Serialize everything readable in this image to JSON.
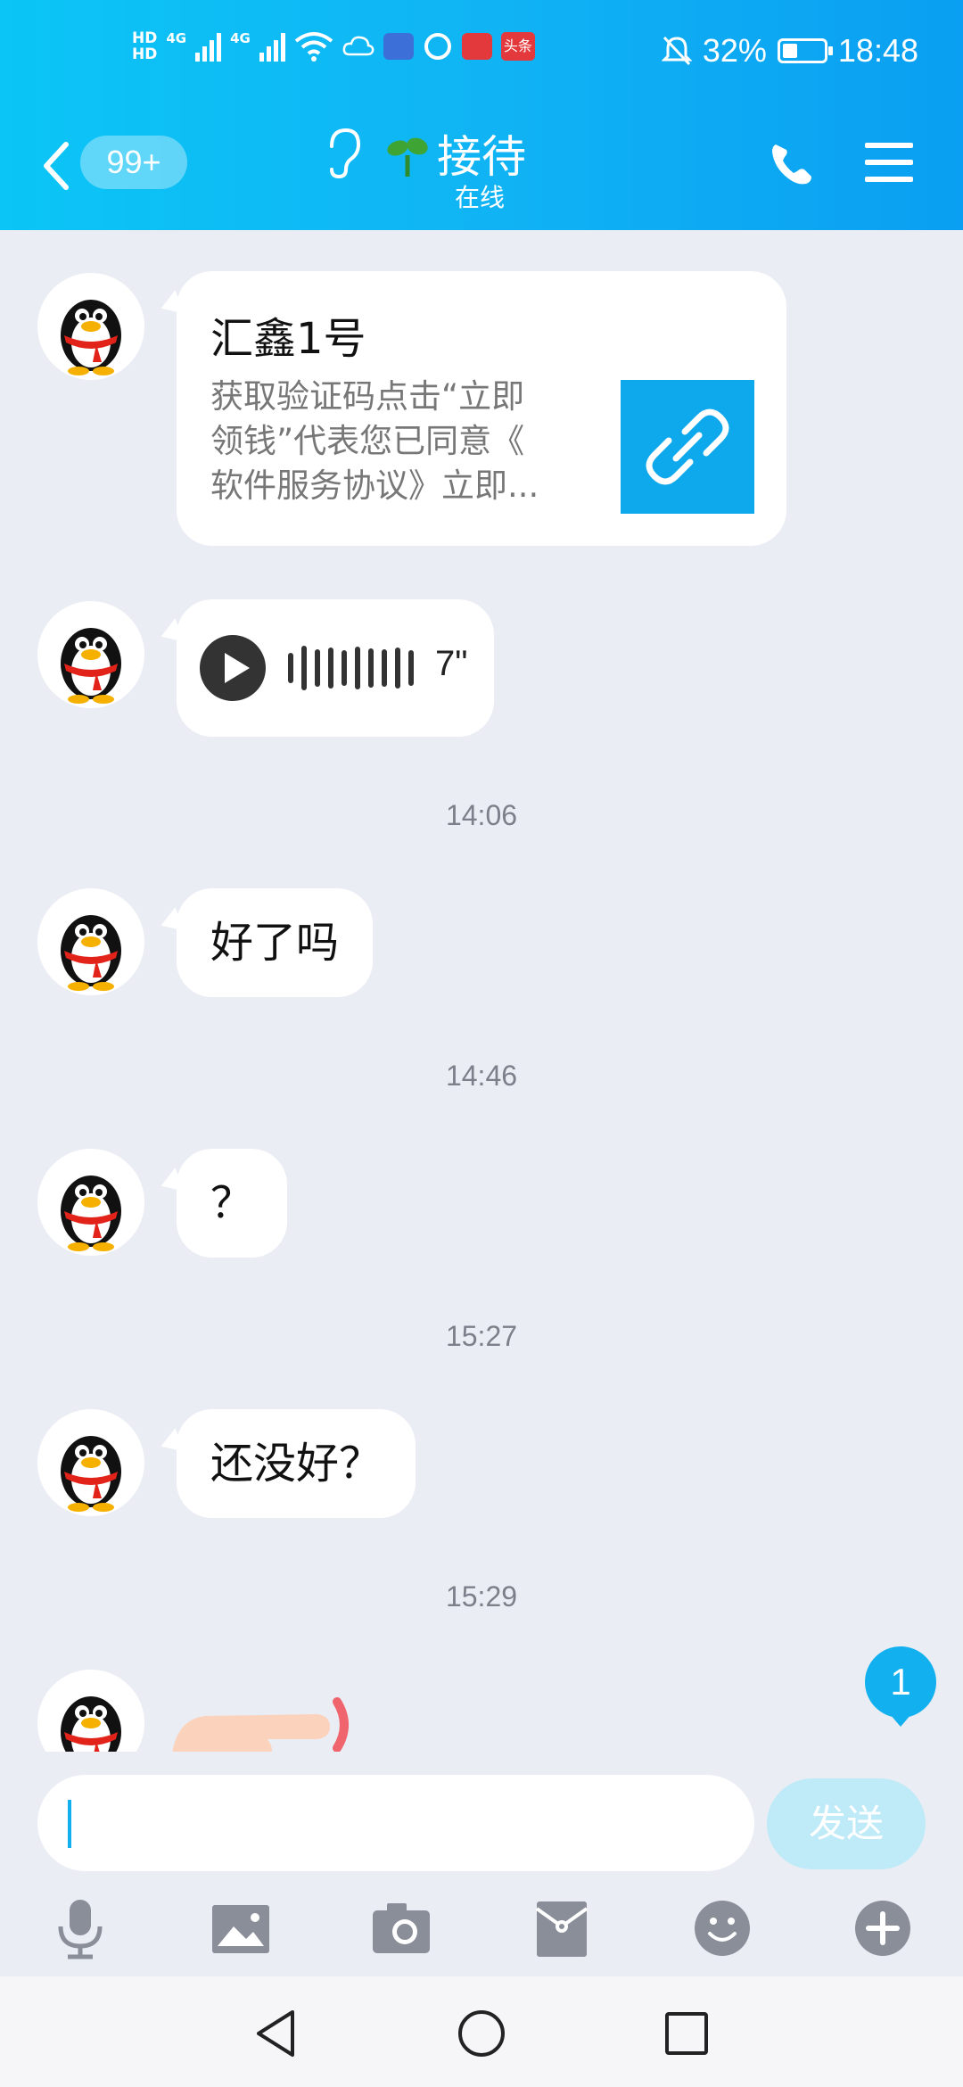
{
  "status_bar": {
    "hd1": "HD",
    "hd2": "HD",
    "net1": "4G",
    "net2": "4G",
    "news_app_label": "头条",
    "battery_percent": "32%",
    "time": "18:48"
  },
  "header": {
    "unread_count": "99+",
    "title": "接待",
    "presence": "在线"
  },
  "messages": {
    "card": {
      "title": "汇鑫1号",
      "desc_line1": "获取验证码点击“立即",
      "desc_line2": "领钱”代表您已同意《",
      "desc_line3": "软件服务协议》立即..."
    },
    "voice": {
      "duration": "7\""
    },
    "ts1": "14:06",
    "msg1": "好了吗",
    "ts2": "14:46",
    "msg2": "？",
    "ts3": "15:27",
    "msg3": "还没好？",
    "ts4": "15:29"
  },
  "new_message_badge": "1",
  "input": {
    "value": "",
    "send_label": "发送"
  },
  "colors": {
    "accent": "#12b0ee",
    "background": "#eaedf4"
  }
}
